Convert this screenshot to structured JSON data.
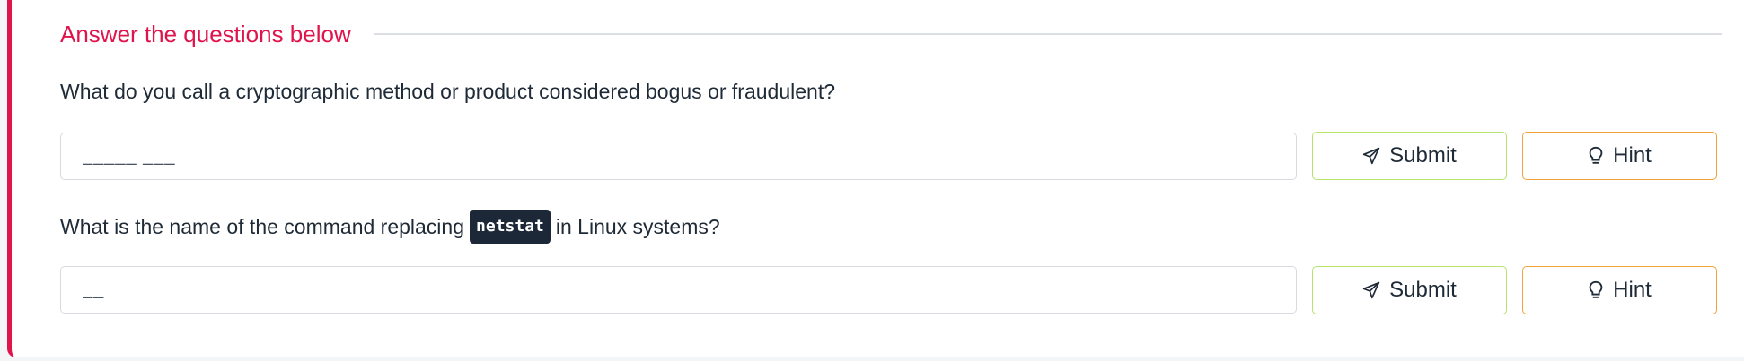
{
  "section": {
    "title": "Answer the questions below"
  },
  "questions": [
    {
      "text_before": "What do you call a cryptographic method or product considered bogus or fraudulent?",
      "code": "",
      "text_after": "",
      "placeholder": "_____ ___",
      "submit_label": "Submit",
      "hint_label": "Hint"
    },
    {
      "text_before": "What is the name of the command replacing",
      "code": "netstat",
      "text_after": "in Linux systems?",
      "placeholder": "__",
      "submit_label": "Submit",
      "hint_label": "Hint"
    }
  ],
  "icons": {
    "submit": "paper-plane-icon",
    "hint": "lightbulb-icon"
  },
  "colors": {
    "accent": "#e0144c",
    "submit_border": "#b6e36b",
    "hint_border": "#f0a43a",
    "code_bg": "#1c2738"
  }
}
